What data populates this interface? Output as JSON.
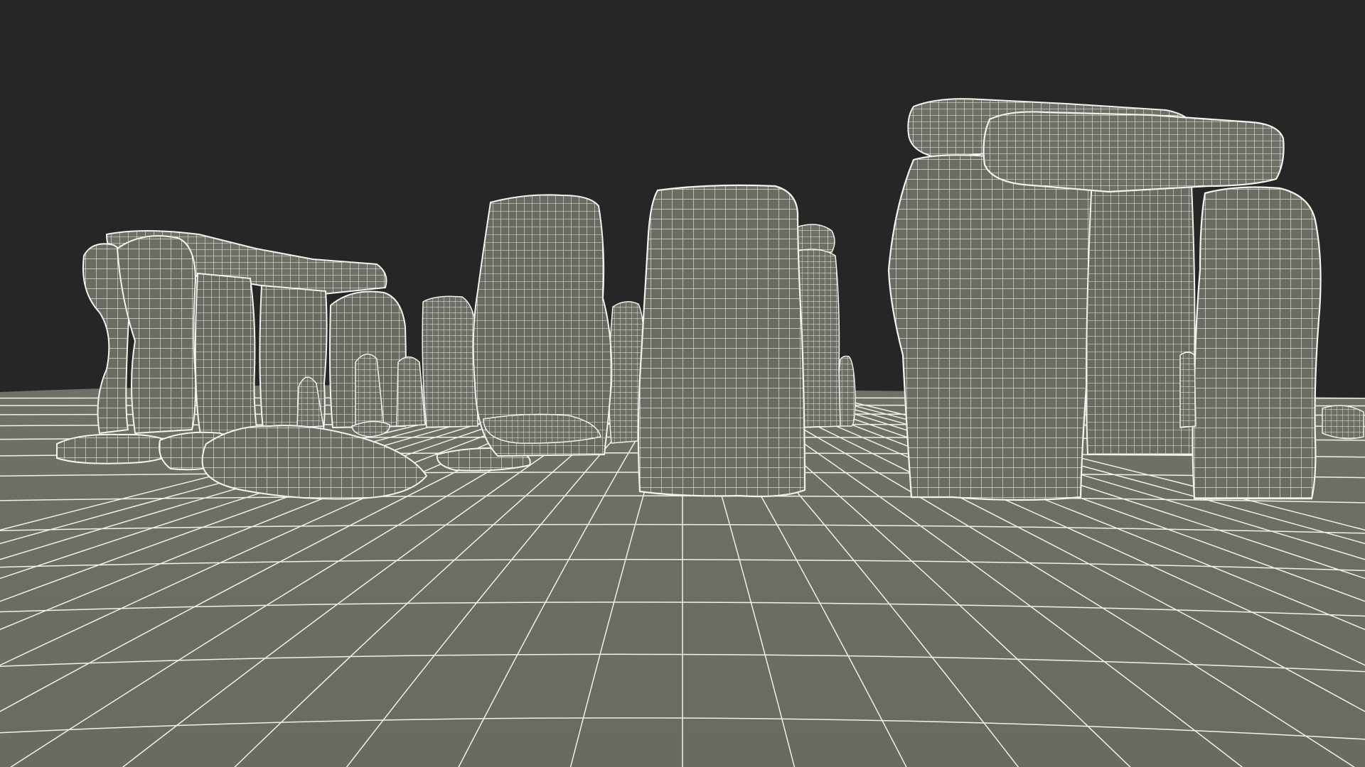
{
  "scene": {
    "subject": "stonehenge-wireframe-render",
    "colors": {
      "background": "#262626",
      "ground": "#6f6f67",
      "stone": "#6b6b63",
      "stone_dark": "#5c5c55",
      "wire": "#f2f2ee"
    }
  }
}
